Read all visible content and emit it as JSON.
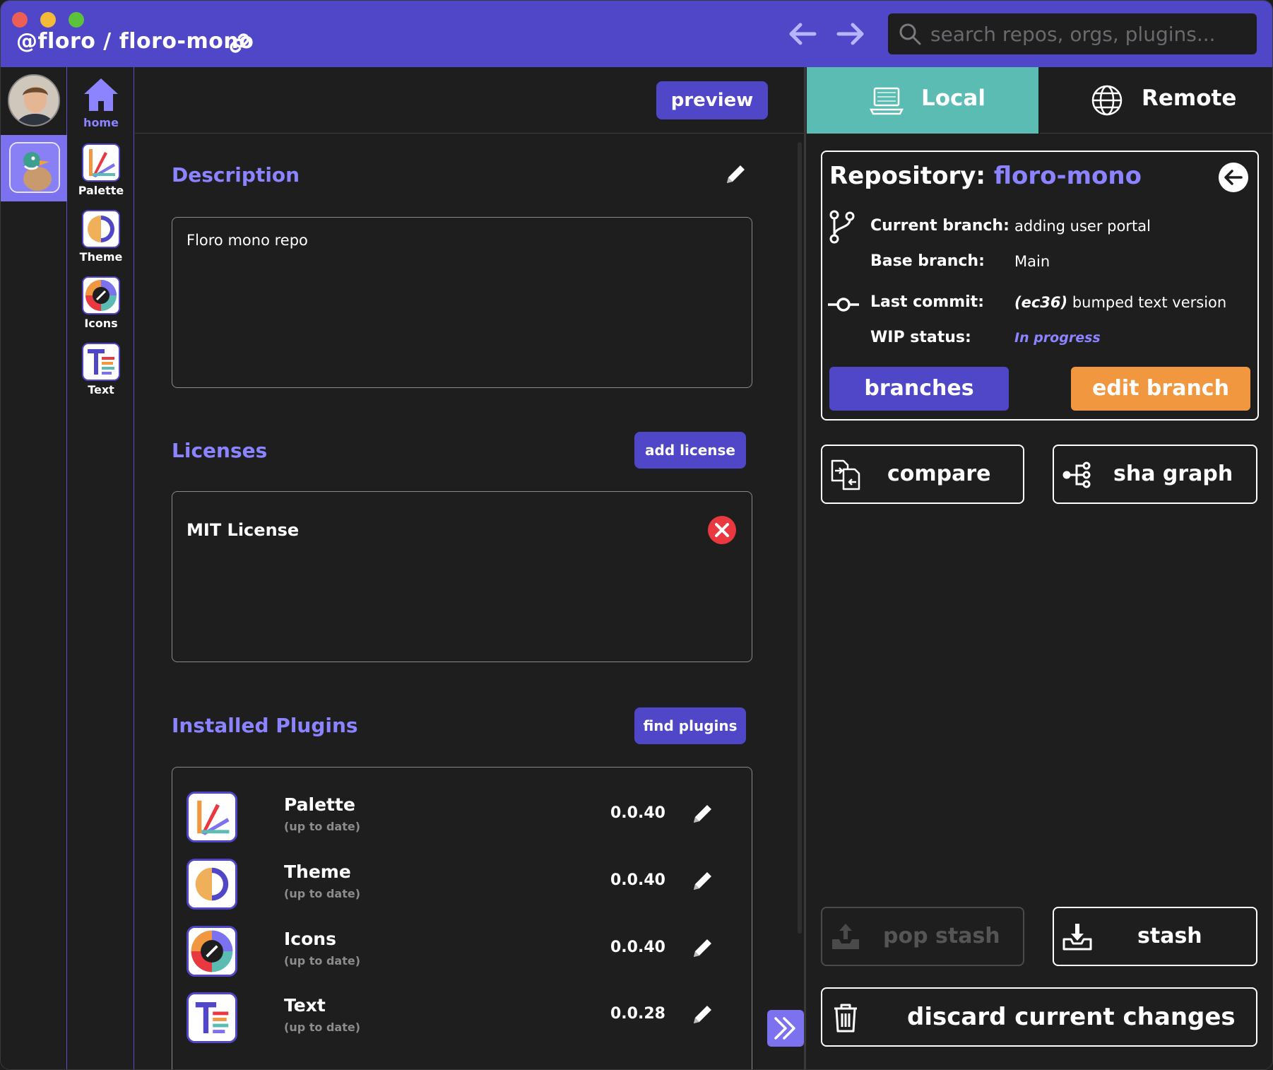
{
  "window": {
    "title": "@floro / floro-mono"
  },
  "search": {
    "placeholder": "search repos, orgs, plugins..."
  },
  "plugin_nav": {
    "home": "home",
    "palette": "Palette",
    "theme": "Theme",
    "icons": "Icons",
    "text": "Text"
  },
  "center": {
    "preview_label": "preview",
    "description": {
      "title": "Description",
      "text": "Floro mono repo"
    },
    "licenses": {
      "title": "Licenses",
      "add_label": "add license",
      "items": [
        "MIT License"
      ]
    },
    "plugins": {
      "title": "Installed Plugins",
      "find_label": "find plugins",
      "items": [
        {
          "name": "Palette",
          "status": "(up to date)",
          "version": "0.0.40",
          "icon": "palette-icon"
        },
        {
          "name": "Theme",
          "status": "(up to date)",
          "version": "0.0.40",
          "icon": "theme-icon"
        },
        {
          "name": "Icons",
          "status": "(up to date)",
          "version": "0.0.40",
          "icon": "icons-icon"
        },
        {
          "name": "Text",
          "status": "(up to date)",
          "version": "0.0.28",
          "icon": "text-icon"
        }
      ]
    }
  },
  "right": {
    "tabs": {
      "local": "Local",
      "remote": "Remote",
      "active": "Local"
    },
    "repo": {
      "heading": "Repository:",
      "name": "floro-mono",
      "current_branch_label": "Current branch:",
      "current_branch": "adding user portal",
      "base_branch_label": "Base branch:",
      "base_branch": "Main",
      "last_commit_label": "Last commit:",
      "last_commit_sha": "(ec36)",
      "last_commit_message": "bumped text version",
      "wip_label": "WIP status:",
      "wip_status": "In progress"
    },
    "buttons": {
      "branches": "branches",
      "edit_branch": "edit branch",
      "compare": "compare",
      "sha_graph": "sha graph",
      "pop_stash": "pop stash",
      "stash": "stash",
      "discard": "discard current changes"
    }
  },
  "colors": {
    "brand_purple": "#4f46c8",
    "accent_purple": "#8b83ff",
    "local_tab": "#5bbcb3",
    "edit_orange": "#f0973f",
    "danger_red": "#e9383f"
  }
}
